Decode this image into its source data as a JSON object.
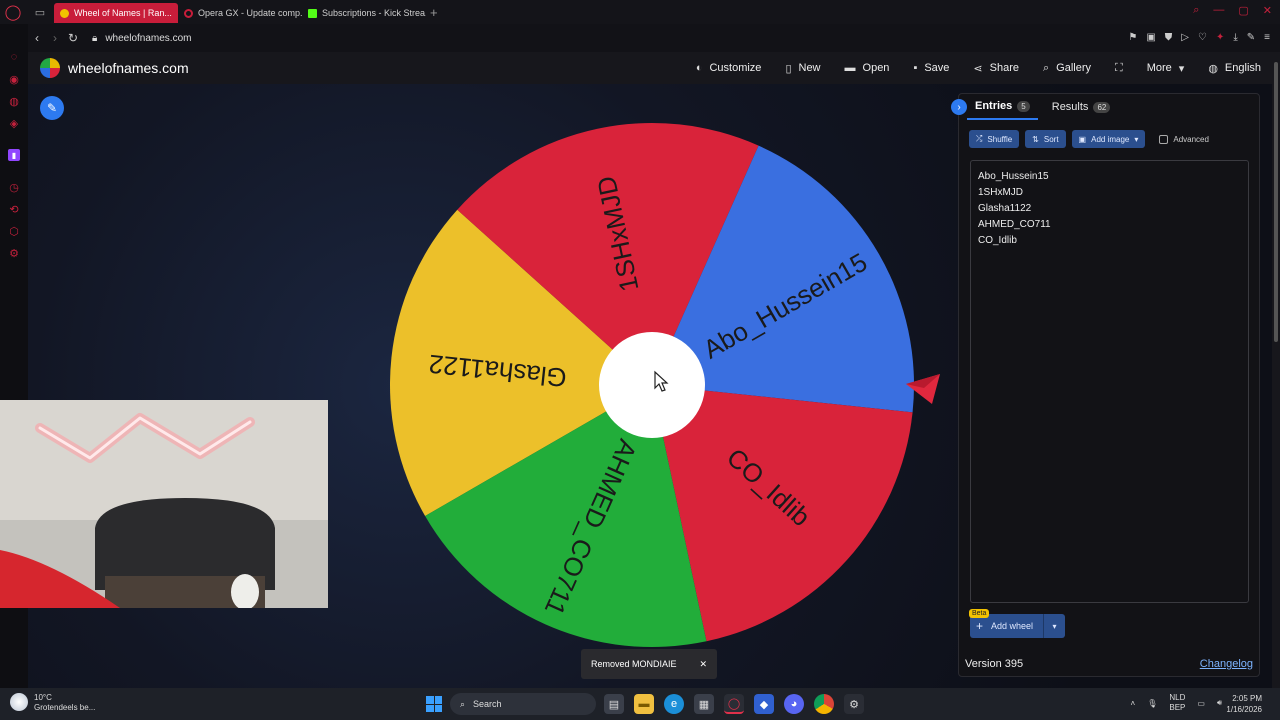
{
  "browser": {
    "tabs": [
      {
        "title": "Wheel of Names | Ran...",
        "active": true,
        "favicon_color": "#d9233a"
      },
      {
        "title": "Opera GX - Update comp...",
        "active": false,
        "favicon_color": "#c81d3a"
      },
      {
        "title": "Subscriptions - Kick Strea...",
        "active": false,
        "favicon_color": "#53fc18"
      }
    ],
    "url": "wheelofnames.com"
  },
  "site": {
    "name": "wheelofnames.com",
    "menu": [
      {
        "label": "Customize",
        "icon": "palette-icon"
      },
      {
        "label": "New",
        "icon": "file-icon"
      },
      {
        "label": "Open",
        "icon": "folder-icon"
      },
      {
        "label": "Save",
        "icon": "floppy-icon"
      },
      {
        "label": "Share",
        "icon": "share-icon"
      },
      {
        "label": "Gallery",
        "icon": "search-icon"
      },
      {
        "label": "",
        "icon": "fullscreen-icon"
      },
      {
        "label": "More",
        "icon": "chevron-down-icon"
      },
      {
        "label": "English",
        "icon": "globe-icon"
      }
    ]
  },
  "wheel": {
    "segments": [
      {
        "label": "Glasha1122",
        "color": "#ecc02a"
      },
      {
        "label": "1SHxMJD",
        "color": "#d9233a"
      },
      {
        "label": "Abo_Hussein15",
        "color": "#3a6fe0"
      },
      {
        "label": "CO_Idlib",
        "color": "#d9233a"
      },
      {
        "label": "AHMED_CO711",
        "color": "#22ad3a"
      }
    ]
  },
  "panel": {
    "tabs": [
      {
        "label": "Entries",
        "count": "5"
      },
      {
        "label": "Results",
        "count": "62"
      }
    ],
    "toolbar": {
      "shuffle": "Shuffle",
      "sort": "Sort",
      "add_image": "Add image",
      "advanced": "Advanced"
    },
    "entries": [
      "Abo_Hussein15",
      "1SHxMJD",
      "Glasha1122",
      "AHMED_CO711",
      "CO_Idlib"
    ],
    "beta_badge": "Beta",
    "add_wheel": "Add wheel",
    "version": "Version 395",
    "changelog": "Changelog"
  },
  "toast": {
    "text": "Removed MONDIAIE",
    "close": "✕"
  },
  "taskbar": {
    "weather_temp": "10°C",
    "weather_desc": "Grotendeels be...",
    "search_placeholder": "Search",
    "lang_top": "NLD",
    "lang_bottom": "BEP",
    "time": "2:05 PM",
    "date": "1/16/2026"
  }
}
